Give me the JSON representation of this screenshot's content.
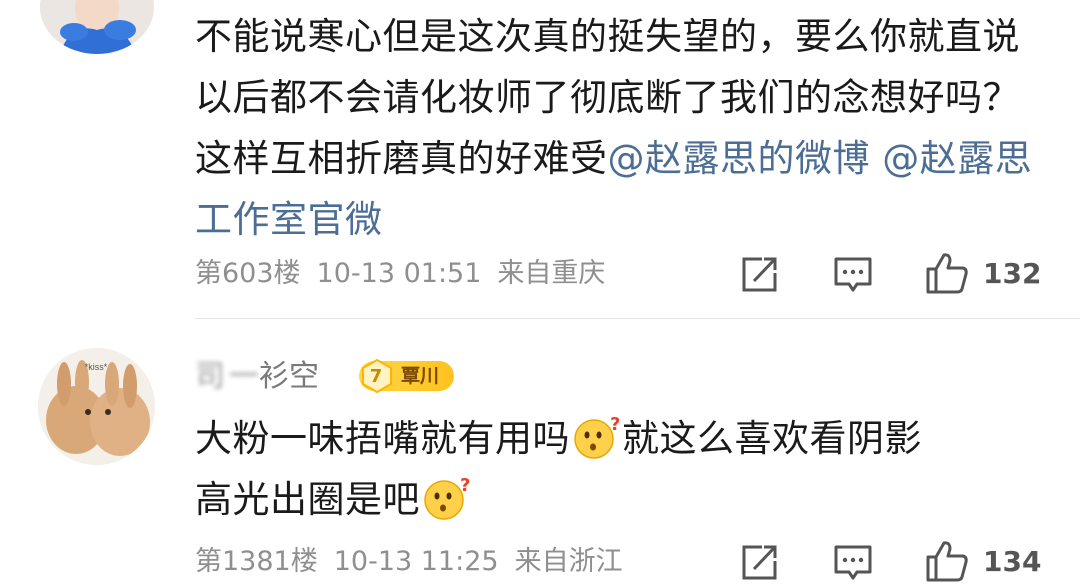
{
  "comment1": {
    "text_parts": {
      "body": "不能说寒心但是这次真的挺失望的，要么你就直说以后都不会请化妆师了彻底断了我们的念想好吗？这样互相折磨真的好难受",
      "mention1": "@赵露思的微博",
      "mention2": "@赵露思工作室官微"
    },
    "floor": "第603楼",
    "time": "10-13 01:51",
    "location": "来自重庆",
    "likes": "132",
    "icons": [
      "repost-icon",
      "comment-icon",
      "like-icon"
    ]
  },
  "comment2": {
    "username": "司",
    "username_rest": "衫空",
    "fan_level": "7",
    "fan_club": "覃川",
    "text_parts": {
      "line1a": "大粉一味捂嘴就有用吗",
      "line1b": "就这么喜欢看阴影",
      "line2": "高光出圈是吧"
    },
    "floor": "第1381楼",
    "time": "10-13 11:25",
    "location": "来自浙江",
    "likes": "134",
    "icons": [
      "repost-icon",
      "comment-icon",
      "like-icon"
    ],
    "avatar_text": "*kiss*"
  },
  "colors": {
    "mention": "#4d6e94",
    "meta": "#8f8f8f",
    "badge": "#ffc21d"
  }
}
